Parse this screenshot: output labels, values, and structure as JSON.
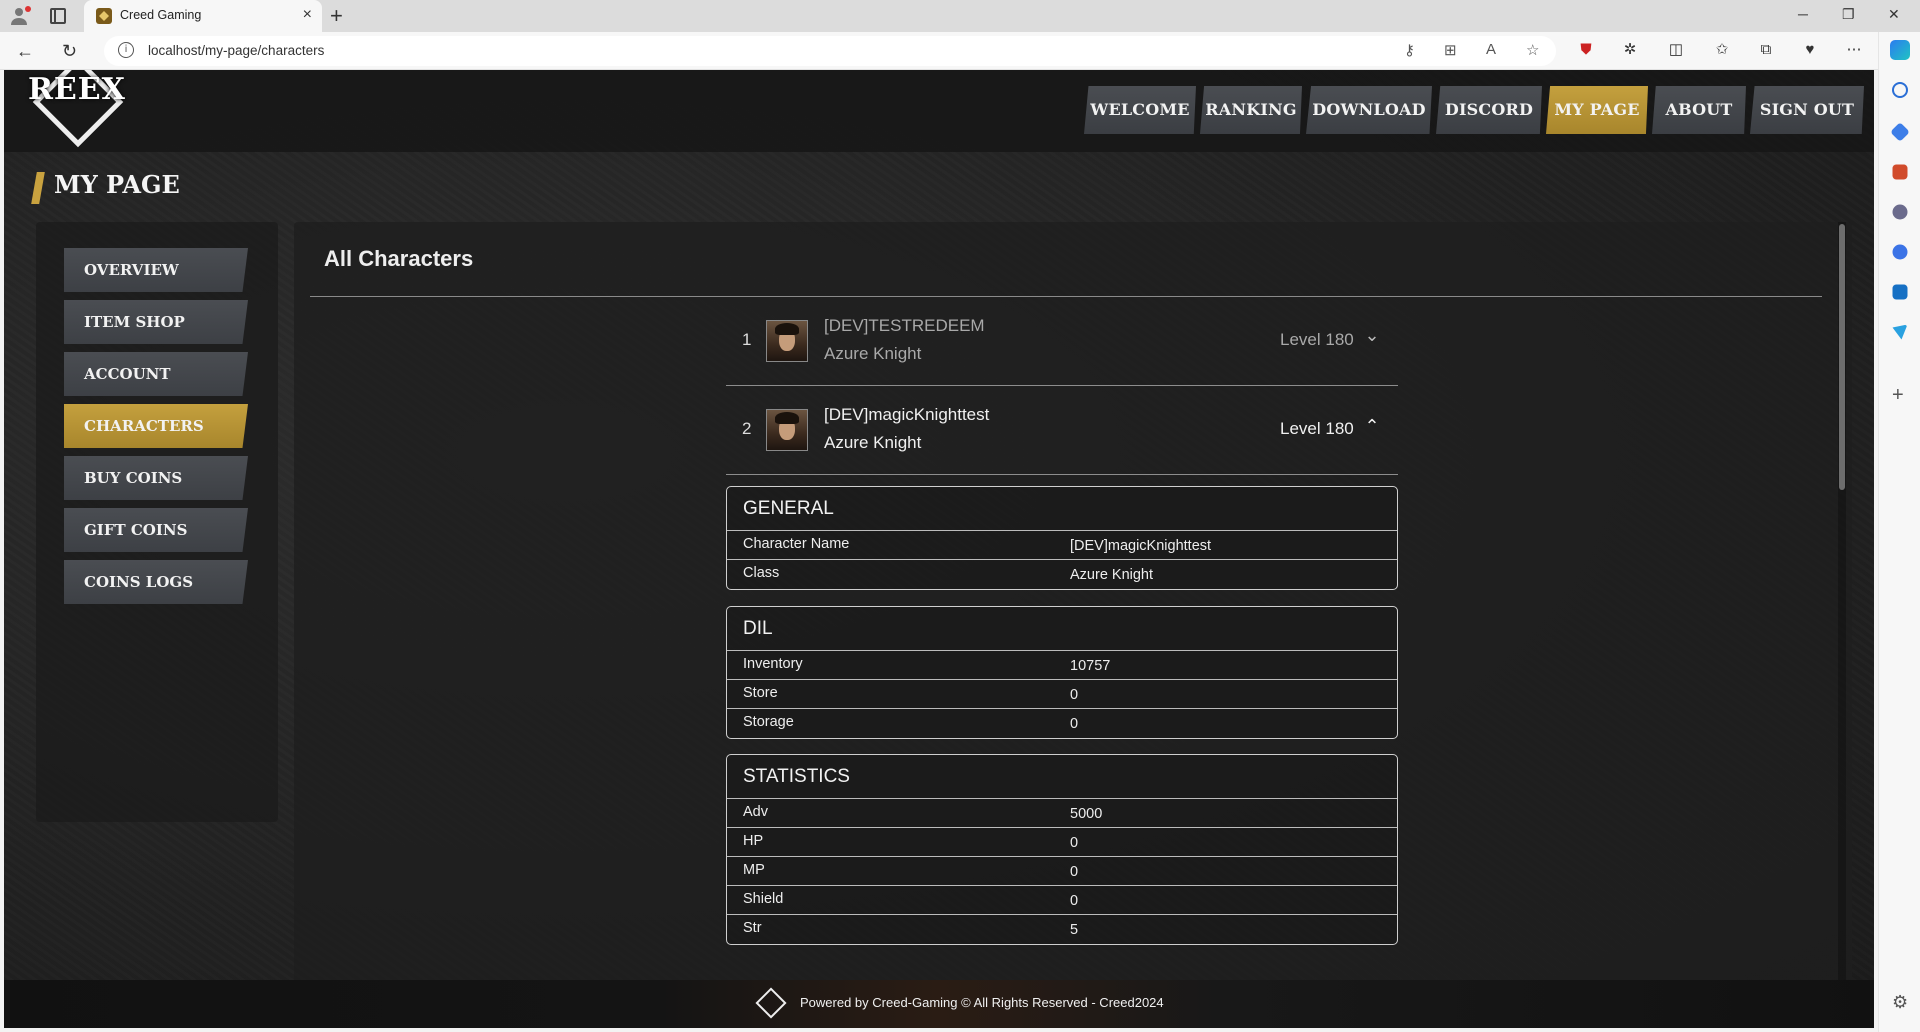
{
  "browser": {
    "tab_title": "Creed Gaming",
    "url": "localhost/my-page/characters"
  },
  "site": {
    "logo_text": "REEX",
    "nav": [
      "WELCOME",
      "RANKING",
      "DOWNLOAD",
      "DISCORD",
      "MY PAGE",
      "ABOUT",
      "SIGN OUT"
    ],
    "active_nav": "MY PAGE",
    "page_title": "MY PAGE"
  },
  "sidebar": {
    "items": [
      "OVERVIEW",
      "ITEM SHOP",
      "ACCOUNT",
      "CHARACTERS",
      "BUY COINS",
      "GIFT COINS",
      "COINS LOGS"
    ],
    "active": "CHARACTERS"
  },
  "content": {
    "title": "All Characters",
    "characters": [
      {
        "index": "1",
        "name": "[DEV]TESTREDEEM",
        "class": "Azure Knight",
        "level": "Level 180",
        "expanded": false
      },
      {
        "index": "2",
        "name": "[DEV]magicKnighttest",
        "class": "Azure Knight",
        "level": "Level 180",
        "expanded": true
      }
    ],
    "panels": [
      {
        "title": "GENERAL",
        "rows": [
          {
            "label": "Character Name",
            "value": "[DEV]magicKnighttest"
          },
          {
            "label": "Class",
            "value": "Azure Knight"
          }
        ]
      },
      {
        "title": "DIL",
        "rows": [
          {
            "label": "Inventory",
            "value": "10757"
          },
          {
            "label": "Store",
            "value": "0"
          },
          {
            "label": "Storage",
            "value": "0"
          }
        ]
      },
      {
        "title": "STATISTICS",
        "rows": [
          {
            "label": "Adv",
            "value": "5000"
          },
          {
            "label": "HP",
            "value": "0"
          },
          {
            "label": "MP",
            "value": "0"
          },
          {
            "label": "Shield",
            "value": "0"
          },
          {
            "label": "Str",
            "value": "5"
          }
        ]
      }
    ]
  },
  "footer": {
    "text": "Powered by Creed-Gaming © All Rights Reserved - Creed2024"
  },
  "colors": {
    "accent_gold": "#c4a03e",
    "button_gray": "#44474c",
    "background": "#222222"
  }
}
